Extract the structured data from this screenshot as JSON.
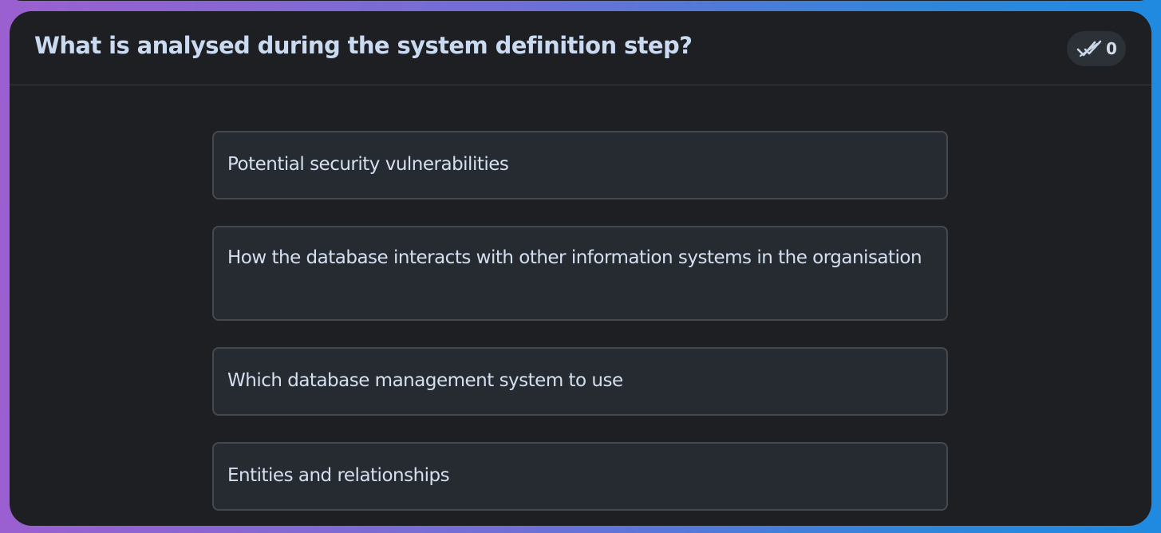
{
  "question": {
    "title": "What is analysed during the system definition step?",
    "answer_count": "0",
    "answer_count_icon": "double-check-icon"
  },
  "options": [
    {
      "label": "Potential security vulnerabilities"
    },
    {
      "label": "How the database interacts with other information systems in the organisation"
    },
    {
      "label": "Which database management system to use"
    },
    {
      "label": "Entities and relationships"
    }
  ],
  "colors": {
    "card_background": "#1e1f22",
    "option_background": "#262a31",
    "option_border": "#444950",
    "title_text": "#c9daf1",
    "gradient_left": "#9b5fd0",
    "gradient_right": "#1f8ae0"
  }
}
